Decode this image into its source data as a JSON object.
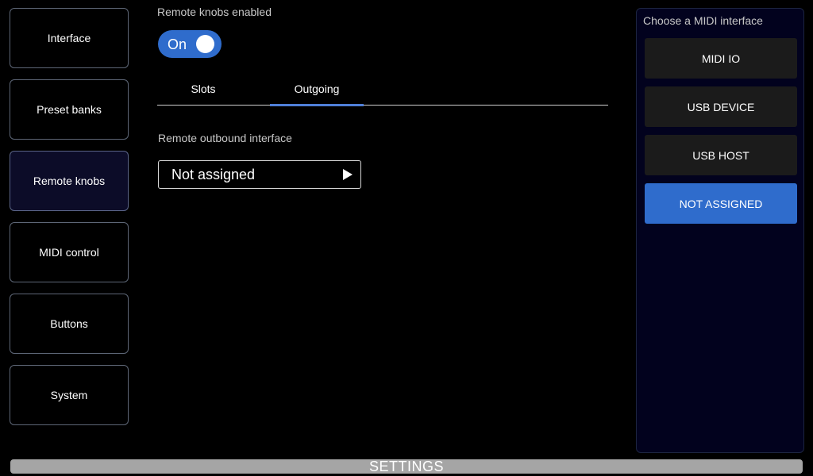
{
  "sidebar": {
    "items": [
      {
        "label": "Interface"
      },
      {
        "label": "Preset banks"
      },
      {
        "label": "Remote knobs"
      },
      {
        "label": "MIDI control"
      },
      {
        "label": "Buttons"
      },
      {
        "label": "System"
      }
    ],
    "active": "Remote knobs"
  },
  "main": {
    "toggle_label": "Remote knobs enabled",
    "toggle_state": "On",
    "tabs": [
      {
        "label": "Slots"
      },
      {
        "label": "Outgoing"
      }
    ],
    "active_tab": "Outgoing",
    "field_label": "Remote outbound interface",
    "field_value": "Not assigned"
  },
  "panel": {
    "title": "Choose a MIDI interface",
    "options": [
      {
        "label": "MIDI IO"
      },
      {
        "label": "USB DEVICE"
      },
      {
        "label": "USB HOST"
      },
      {
        "label": "NOT ASSIGNED"
      }
    ],
    "selected": "NOT ASSIGNED"
  },
  "footer": {
    "title": "SETTINGS"
  },
  "colors": {
    "accent": "#2f6ccc",
    "tab_indicator": "#4f7fd8",
    "panel_bg": "#02021e",
    "active_nav_bg": "#0c0c28"
  }
}
